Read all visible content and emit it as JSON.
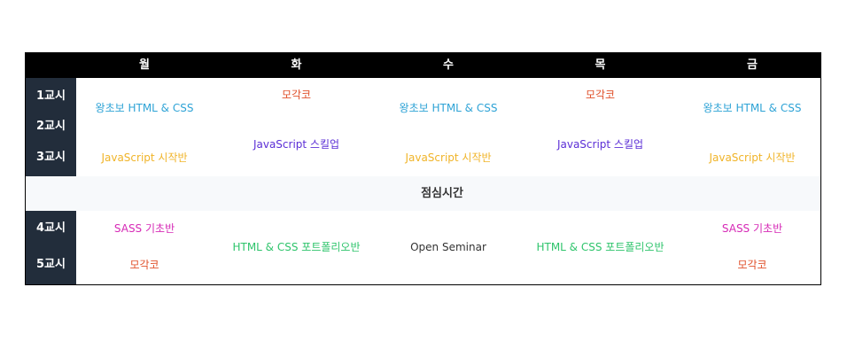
{
  "colors": {
    "header_bg": "#000000",
    "period_bg": "#222d3b",
    "lunch_bg": "#f7f9fb",
    "html_css_blue": "#2ea3d6",
    "mogakko_red": "#e0512b",
    "js_script_purple": "#5b2ed6",
    "js_start_yellow": "#f0b429",
    "sass_magenta": "#d629b6",
    "portfolio_green": "#2ec46b",
    "seminar_dark": "#333333"
  },
  "days": [
    "월",
    "화",
    "수",
    "목",
    "금"
  ],
  "periods": [
    "1교시",
    "2교시",
    "3교시",
    "4교시",
    "5교시"
  ],
  "lunch": "점심시간",
  "classes": {
    "mon_1_2": "왕초보 HTML & CSS",
    "mon_3": "JavaScript 시작반",
    "tue_1": "모각코",
    "tue_2_3": "JavaScript 스킬업",
    "wed_1_2": "왕초보 HTML & CSS",
    "wed_3": "JavaScript 시작반",
    "thu_1": "모각코",
    "thu_2_3": "JavaScript 스킬업",
    "fri_1_2": "왕초보 HTML & CSS",
    "fri_3": "JavaScript 시작반",
    "mon_4": "SASS 기초반",
    "mon_5": "모각코",
    "tue_4_5": "HTML & CSS 포트폴리오반",
    "wed_4_5": "Open Seminar",
    "thu_4_5": "HTML & CSS 포트폴리오반",
    "fri_4": "SASS 기초반",
    "fri_5": "모각코"
  }
}
